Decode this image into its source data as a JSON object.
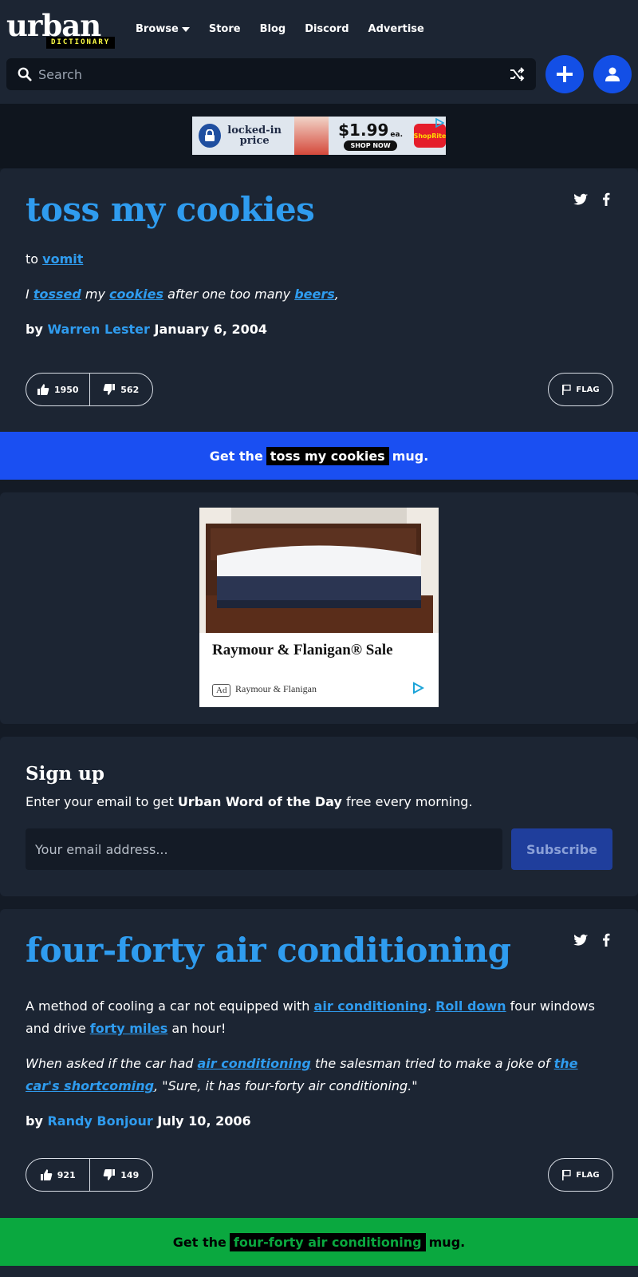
{
  "header": {
    "logo_word": "urban",
    "logo_tag": "DICTIONARY",
    "nav": [
      "Browse",
      "Store",
      "Blog",
      "Discord",
      "Advertise"
    ],
    "search_placeholder": "Search"
  },
  "top_ad": {
    "headline": "locked-in price",
    "price": "$1.99",
    "price_note": "ea.",
    "cta": "SHOP NOW",
    "store_logo": "ShopRite"
  },
  "definitions": [
    {
      "word": "toss my cookies",
      "meaning": {
        "prefix": "to ",
        "link": "vomit"
      },
      "example": {
        "p1": "I ",
        "l1": "tossed",
        "p2": " my ",
        "l2": "cookies",
        "p3": " after one too many ",
        "l3": "beers",
        "p4": ","
      },
      "by": "by",
      "author": "Warren Lester",
      "date": "January 6, 2004",
      "upvotes": "1950",
      "downvotes": "562",
      "flag_label": "FLAG",
      "mug": {
        "before": "Get the",
        "word": "toss my cookies",
        "after": "mug."
      },
      "mug_color": "#1a4ff2"
    },
    {
      "word": "four-forty air conditioning",
      "meaning": {
        "p1": "A method of cooling a car not equipped with ",
        "l1": "air conditioning",
        "p2": ". ",
        "l2": "Roll down",
        "p3": " four windows and drive ",
        "l3": "forty miles",
        "p4": " an hour!"
      },
      "example": {
        "p1": "When asked if the car had ",
        "l1": "air conditioning",
        "p2": " the salesman tried to make a joke of ",
        "l2": "the car's shortcoming",
        "p3": ", \"Sure, it has four-forty air conditioning.\""
      },
      "by": "by",
      "author": "Randy Bonjour",
      "date": "July 10, 2006",
      "upvotes": "921",
      "downvotes": "149",
      "flag_label": "FLAG",
      "mug": {
        "before": "Get the",
        "word": "four-forty air conditioning",
        "after": "mug."
      },
      "mug_color": "#0aa83f"
    }
  ],
  "mid_ad": {
    "title": "Raymour & Flanigan® Sale",
    "badge": "Ad",
    "source": "Raymour & Flanigan"
  },
  "signup": {
    "title": "Sign up",
    "text_before": "Enter your email to get ",
    "text_bold": "Urban Word of the Day",
    "text_after": " free every morning.",
    "email_placeholder": "Your email address...",
    "subscribe_label": "Subscribe"
  },
  "colors": {
    "accent_blue": "#2f9cef",
    "primary_button": "#134fe6",
    "card_bg": "#1c2533",
    "page_bg": "#141b26"
  }
}
